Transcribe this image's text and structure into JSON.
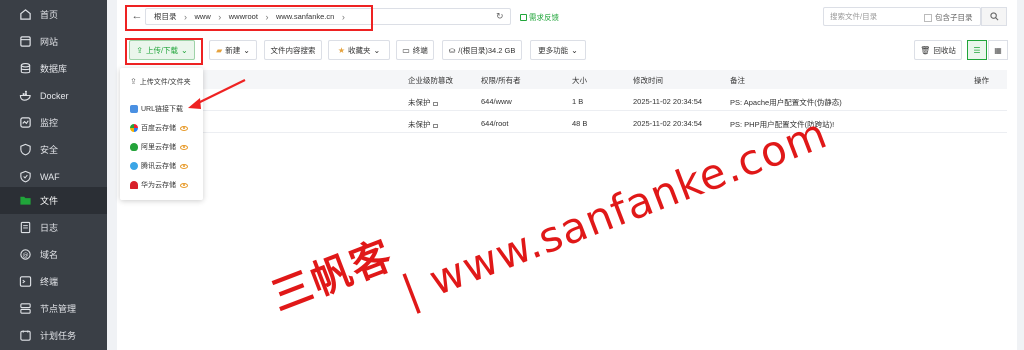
{
  "sidebar": {
    "items": [
      {
        "label": "首页",
        "icon": "home-icon"
      },
      {
        "label": "网站",
        "icon": "website-icon"
      },
      {
        "label": "数据库",
        "icon": "database-icon"
      },
      {
        "label": "Docker",
        "icon": "docker-icon"
      },
      {
        "label": "监控",
        "icon": "monitor-icon"
      },
      {
        "label": "安全",
        "icon": "shield-icon"
      },
      {
        "label": "WAF",
        "icon": "waf-icon"
      },
      {
        "label": "文件",
        "icon": "folder-icon",
        "active": true
      },
      {
        "label": "日志",
        "icon": "log-icon"
      },
      {
        "label": "域名",
        "icon": "domain-icon"
      },
      {
        "label": "终端",
        "icon": "terminal-icon"
      },
      {
        "label": "节点管理",
        "icon": "node-icon"
      },
      {
        "label": "计划任务",
        "icon": "clock-icon"
      }
    ]
  },
  "path": {
    "crumbs": [
      "根目录",
      "www",
      "wwwroot",
      "www.sanfanke.cn"
    ],
    "feedback": "需求反馈"
  },
  "search": {
    "placeholder": "搜索文件/目录",
    "include_subdir": "包含子目录"
  },
  "toolbar": {
    "upload": "上传/下载",
    "new": "新建",
    "content_search": "文件内容搜索",
    "favorites": "收藏夹",
    "terminal": "终端",
    "disk": "/(根目录)34.2 GB",
    "more": "更多功能",
    "recycle": "回收站"
  },
  "table": {
    "headers": {
      "tamper": "企业级防篡改",
      "perm": "权限/所有者",
      "size": "大小",
      "mtime": "修改时间",
      "note": "备注",
      "ops": "操作"
    },
    "rows": [
      {
        "tamper": "未保护",
        "perm": "644/www",
        "size": "1 B",
        "mtime": "2025-11-02 20:34:54",
        "note": "PS: Apache用户配置文件(伪静态)"
      },
      {
        "tamper": "未保护",
        "perm": "644/root",
        "size": "48 B",
        "mtime": "2025-11-02 20:34:54",
        "note": "PS: PHP用户配置文件(防跨站)!"
      }
    ]
  },
  "dropdown": {
    "items": [
      {
        "label": "上传文件/文件夹",
        "icon": "upload-icon"
      },
      {
        "label": "URL链接下载",
        "icon": "url-file-icon"
      },
      {
        "label": "百度云存储",
        "icon": "baidu-cloud-icon",
        "eye": true
      },
      {
        "label": "阿里云存储",
        "icon": "aliyun-icon",
        "eye": true
      },
      {
        "label": "腾讯云存储",
        "icon": "tencent-cloud-icon",
        "eye": true
      },
      {
        "label": "华为云存储",
        "icon": "huawei-cloud-icon",
        "eye": true
      }
    ]
  },
  "watermark": {
    "chinese": "三帆客",
    "site": "| www.sanfanke.com"
  },
  "colors": {
    "accent": "#20a53a",
    "sidebar": "#3a3f46",
    "highlight": "#e22222"
  }
}
